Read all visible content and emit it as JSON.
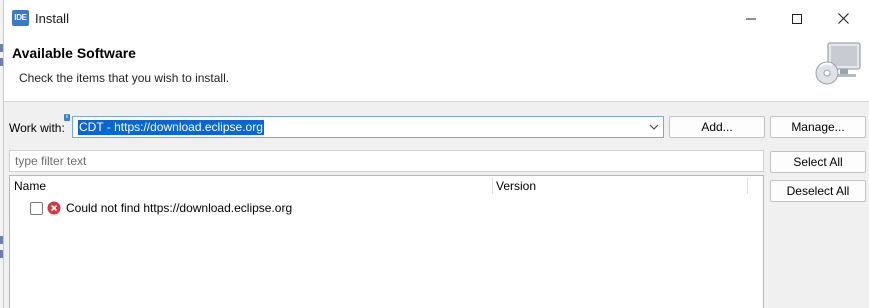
{
  "window": {
    "title": "Install",
    "app_icon_text": "IDE",
    "minimize_icon": "minimize-icon",
    "maximize_icon": "maximize-icon",
    "close_icon": "close-icon"
  },
  "header": {
    "title": "Available Software",
    "description": "Check the items that you wish to install.",
    "icon": "install-cd-monitor-icon"
  },
  "work_with": {
    "label": "Work with:",
    "value": "CDT - https://download.eclipse.org",
    "info_icon": "info-decoration-icon",
    "dropdown_icon": "chevron-down-icon"
  },
  "buttons": {
    "add": "Add...",
    "manage": "Manage...",
    "select_all": "Select All",
    "deselect_all": "Deselect All"
  },
  "filter": {
    "placeholder": "type filter text"
  },
  "tree": {
    "columns": [
      "Name",
      "Version"
    ],
    "rows": [
      {
        "checked": false,
        "status_icon": "error-icon",
        "name": "Could not find https://download.eclipse.org",
        "version": ""
      }
    ]
  },
  "colors": {
    "accent": "#0a66d6",
    "error": "#d9363e",
    "app_icon": "#3a78c9"
  }
}
